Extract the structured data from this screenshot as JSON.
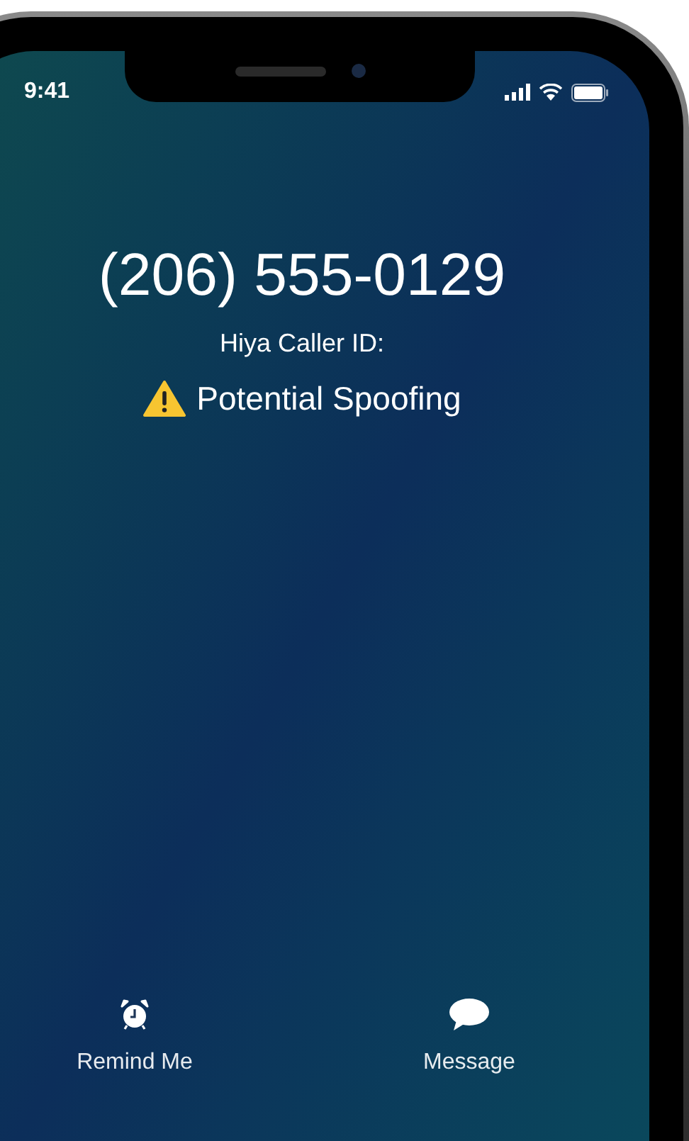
{
  "status_bar": {
    "time": "9:41"
  },
  "caller": {
    "number": "(206) 555-0129",
    "source": "Hiya Caller ID:",
    "warning": "Potential Spoofing"
  },
  "actions": [
    {
      "kind": "remind",
      "label": "Remind Me"
    },
    {
      "kind": "message",
      "label": "Message"
    }
  ]
}
